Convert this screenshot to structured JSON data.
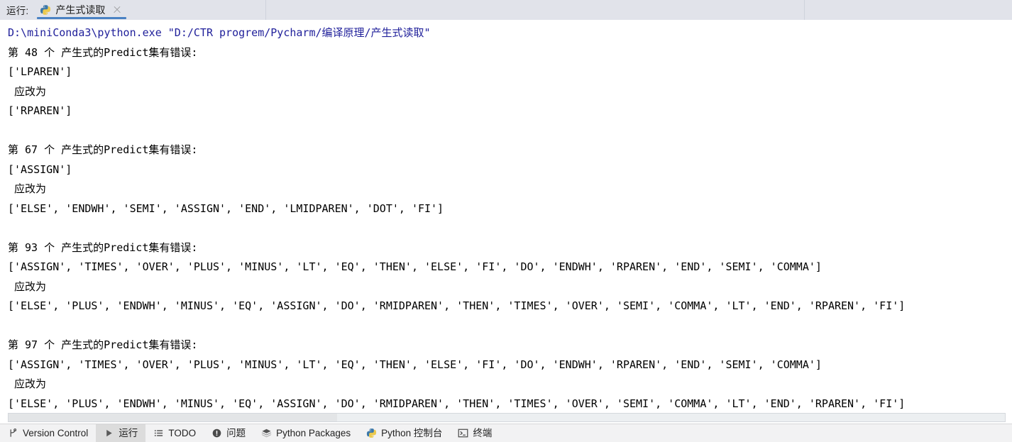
{
  "window": {
    "tool_window_title": "运行:",
    "tab": {
      "label": "产生式读取",
      "icon": "python-icon",
      "close_icon": "close-icon"
    }
  },
  "console": {
    "lines": [
      {
        "text": "D:\\miniConda3\\python.exe \"D:/CTR progrem/Pycharm/编译原理/产生式读取\"",
        "style": "cmd"
      },
      {
        "text": "第 48 个 产生式的Predict集有错误:",
        "style": "normal"
      },
      {
        "text": "['LPAREN']",
        "style": "normal"
      },
      {
        "text": " 应改为",
        "style": "normal"
      },
      {
        "text": "['RPAREN']",
        "style": "normal"
      },
      {
        "text": "",
        "style": "blank"
      },
      {
        "text": "第 67 个 产生式的Predict集有错误:",
        "style": "normal"
      },
      {
        "text": "['ASSIGN']",
        "style": "normal"
      },
      {
        "text": " 应改为",
        "style": "normal"
      },
      {
        "text": "['ELSE', 'ENDWH', 'SEMI', 'ASSIGN', 'END', 'LMIDPAREN', 'DOT', 'FI']",
        "style": "normal"
      },
      {
        "text": "",
        "style": "blank"
      },
      {
        "text": "第 93 个 产生式的Predict集有错误:",
        "style": "normal"
      },
      {
        "text": "['ASSIGN', 'TIMES', 'OVER', 'PLUS', 'MINUS', 'LT', 'EQ', 'THEN', 'ELSE', 'FI', 'DO', 'ENDWH', 'RPAREN', 'END', 'SEMI', 'COMMA']",
        "style": "normal"
      },
      {
        "text": " 应改为",
        "style": "normal"
      },
      {
        "text": "['ELSE', 'PLUS', 'ENDWH', 'MINUS', 'EQ', 'ASSIGN', 'DO', 'RMIDPAREN', 'THEN', 'TIMES', 'OVER', 'SEMI', 'COMMA', 'LT', 'END', 'RPAREN', 'FI']",
        "style": "normal"
      },
      {
        "text": "",
        "style": "blank"
      },
      {
        "text": "第 97 个 产生式的Predict集有错误:",
        "style": "normal"
      },
      {
        "text": "['ASSIGN', 'TIMES', 'OVER', 'PLUS', 'MINUS', 'LT', 'EQ', 'THEN', 'ELSE', 'FI', 'DO', 'ENDWH', 'RPAREN', 'END', 'SEMI', 'COMMA']",
        "style": "normal"
      },
      {
        "text": " 应改为",
        "style": "normal"
      },
      {
        "text": "['ELSE', 'PLUS', 'ENDWH', 'MINUS', 'EQ', 'ASSIGN', 'DO', 'RMIDPAREN', 'THEN', 'TIMES', 'OVER', 'SEMI', 'COMMA', 'LT', 'END', 'RPAREN', 'FI']",
        "style": "normal"
      }
    ],
    "command_text_color": "#21219b",
    "output_text_color": "#000000"
  },
  "statusbar": {
    "items": [
      {
        "label": "Version Control",
        "icon": "branch-icon",
        "active": false
      },
      {
        "label": "运行",
        "icon": "play-icon",
        "active": true
      },
      {
        "label": "TODO",
        "icon": "list-icon",
        "active": false
      },
      {
        "label": "问题",
        "icon": "warning-icon",
        "active": false
      },
      {
        "label": "Python Packages",
        "icon": "layers-icon",
        "active": false
      },
      {
        "label": "Python 控制台",
        "icon": "python-icon",
        "active": false
      },
      {
        "label": "终端",
        "icon": "terminal-icon",
        "active": false
      }
    ]
  },
  "theme": {
    "header_bg": "#e1e3ea",
    "tab_underline": "#4a82c4",
    "statusbar_bg": "#f2f2f3",
    "active_item_bg": "#dcdcdc",
    "console_bg": "#ffffff"
  }
}
